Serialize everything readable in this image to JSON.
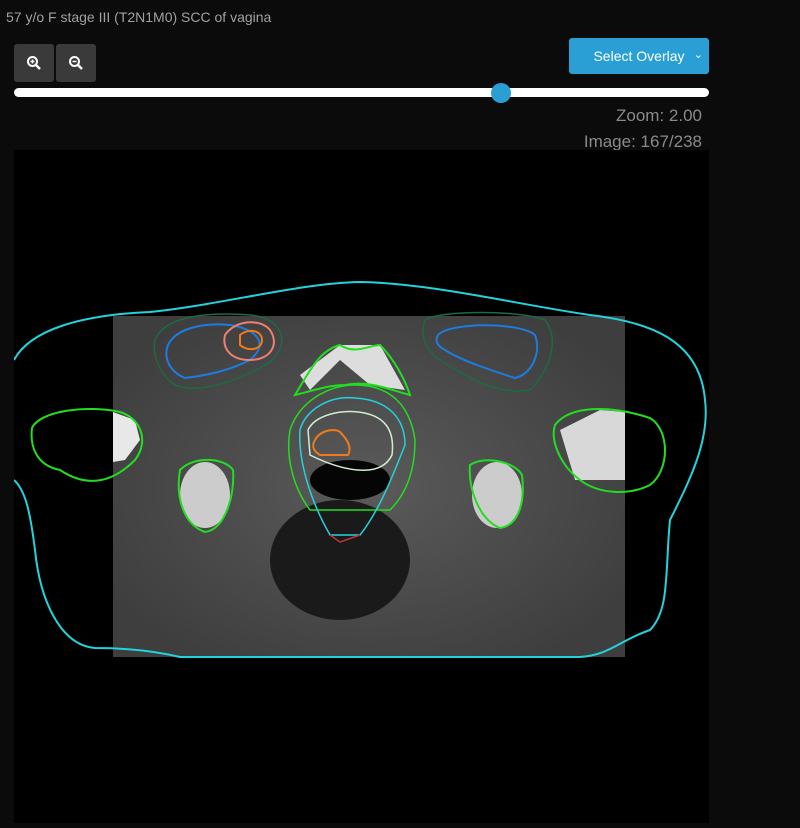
{
  "header": {
    "title": "57 y/o F stage III (T2N1M0) SCC of vagina"
  },
  "toolbar": {
    "zoom_in_icon": "zoom-in-icon",
    "zoom_out_icon": "zoom-out-icon",
    "overlay_label": "Select Overlay"
  },
  "slider": {
    "value": 167,
    "max": 238,
    "fraction": 0.7
  },
  "status": {
    "zoom": "Zoom: 2.00",
    "image": "Image: 167/238"
  },
  "colors": {
    "accent": "#2a9fd6",
    "body": "#22d3dc",
    "bone": "#22dd22",
    "node": "#1e7be0",
    "gtv": "#f07a1a"
  }
}
